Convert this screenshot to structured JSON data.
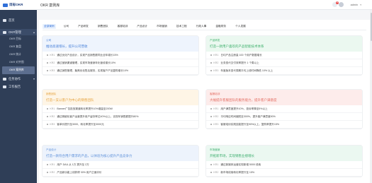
{
  "app": {
    "logo_text": "目标OKR",
    "page_title": "OKR 案例库",
    "notification_count": "14",
    "user_name": "admin",
    "user_caret": "▾"
  },
  "sidebar": {
    "home": "首页",
    "okr_section": "OKR管理",
    "okr_section_chevron": "▴",
    "sub_items": [
      "OKR 目标",
      "OKR 复盘",
      "OKR 统计",
      "OKR 对齐图",
      "OKR 案例库"
    ],
    "task": "任务协作",
    "task_chevron": "▾",
    "report": "工作报告"
  },
  "tabs": [
    "全部案例",
    "公司",
    "产品研发",
    "销售团队",
    "客服培训",
    "产品设计",
    "市场营销",
    "技术工程",
    "行政人事",
    "金融财务",
    "个人发展"
  ],
  "cards": [
    {
      "type": "公司",
      "objective": "推动高速增长，提升公司营收",
      "krs": [
        {
          "code": "KR1",
          "text": "通过优化产品设计，实现产品销售额同比全年增长15%"
        },
        {
          "code": "KR2",
          "text": "通过营销渠道管理，实现市场营销年化营收增长10%"
        },
        {
          "code": "KR3",
          "text": "通过销售管理，聚焦优化售后服务，实现客户产品复购增长10%"
        }
      ]
    },
    {
      "type": "产品研发",
      "objective": "打造一款用户喜欢的产品智能技术体系",
      "krs": [
        {
          "code": "KR1",
          "text": "日均产品注册量 100 个用户数据增长"
        },
        {
          "code": "KR2",
          "text": "业务迭代交付效率提升 1 个周以上"
        },
        {
          "code": "KR3",
          "text": "年度版本迭代周期平均上线时间降低 10% 以上"
        }
      ]
    },
    {
      "type": "销售团队",
      "objective": "打造一支以客户为中心的销售团队",
      "krs": [
        {
          "code": "KR1",
          "text": "Banner广告投放渠道转化率提升10%增量至200W"
        },
        {
          "code": "KR2",
          "text": "通过精细化客户运营提升用户留存率达40%以上，实现年销售额提升80%"
        },
        {
          "code": "KR3",
          "text": "客单价提升至3000，转化率提升至3000元"
        }
      ]
    },
    {
      "type": "客服培训",
      "objective": "大幅提升客服团队的服务能力，提升客户满意度",
      "krs": [
        {
          "code": "KR1",
          "text": "用户满意度提升10%，投诉率降至5%以上"
        },
        {
          "code": "KR2",
          "text": "平均响应时间缩短至300%，提升客户满意度90%"
        },
        {
          "code": "KR3",
          "text": "客服培训实践技能提升至90%以上，复购率提升15%"
        }
      ]
    },
    {
      "type": "产品设计",
      "objective": "打造一款符合用户需求的产品，以体验为核心提升产品竞争力",
      "krs": [
        {
          "code": "KR1",
          "text": "用户 DAU 从 1万 提升至 2万"
        },
        {
          "code": "KR2",
          "text": "产品新功能上线获得 30% 用户正面评价"
        }
      ]
    },
    {
      "type": "市场营销",
      "objective": "开拓新市场，实现销售业绩增长",
      "krs": [
        {
          "code": "KR1",
          "text": "通过新媒体运营实现新增 5000 线索"
        },
        {
          "code": "KR2",
          "text": "新市场线索转化率提升至 15%"
        }
      ]
    }
  ]
}
